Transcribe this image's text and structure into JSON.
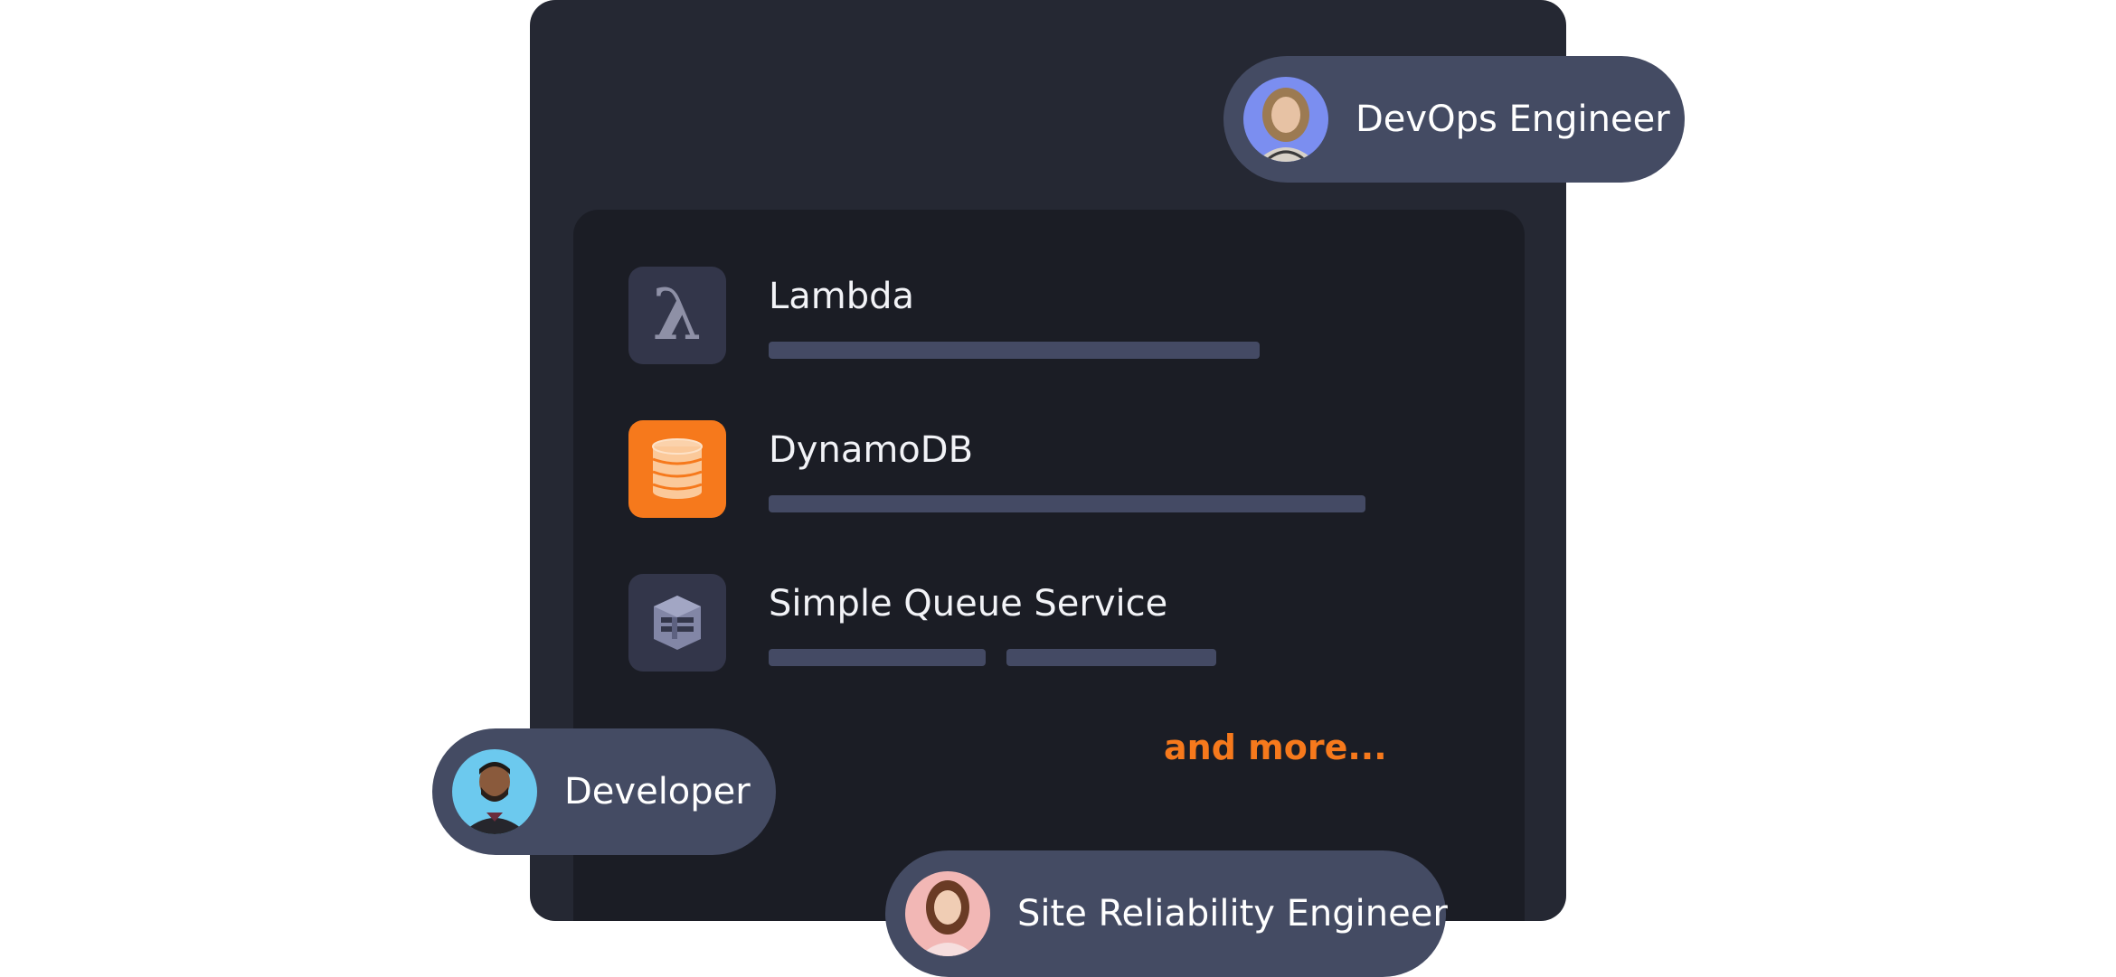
{
  "services": [
    {
      "name": "Lambda",
      "icon": "lambda-icon"
    },
    {
      "name": "DynamoDB",
      "icon": "database-icon"
    },
    {
      "name": "Simple Queue Service",
      "icon": "queue-icon"
    }
  ],
  "more_label": "and more...",
  "roles": [
    {
      "label": "DevOps Engineer",
      "avatar": "avatar-woman-blonde"
    },
    {
      "label": "Developer",
      "avatar": "avatar-man-bearded"
    },
    {
      "label": "Site Reliability Engineer",
      "avatar": "avatar-woman-brunette"
    }
  ],
  "colors": {
    "accent_orange": "#f6791c",
    "card": "#252833",
    "panel": "#1b1d25",
    "pill": "#444b63",
    "placeholder_bar": "#444a64"
  }
}
